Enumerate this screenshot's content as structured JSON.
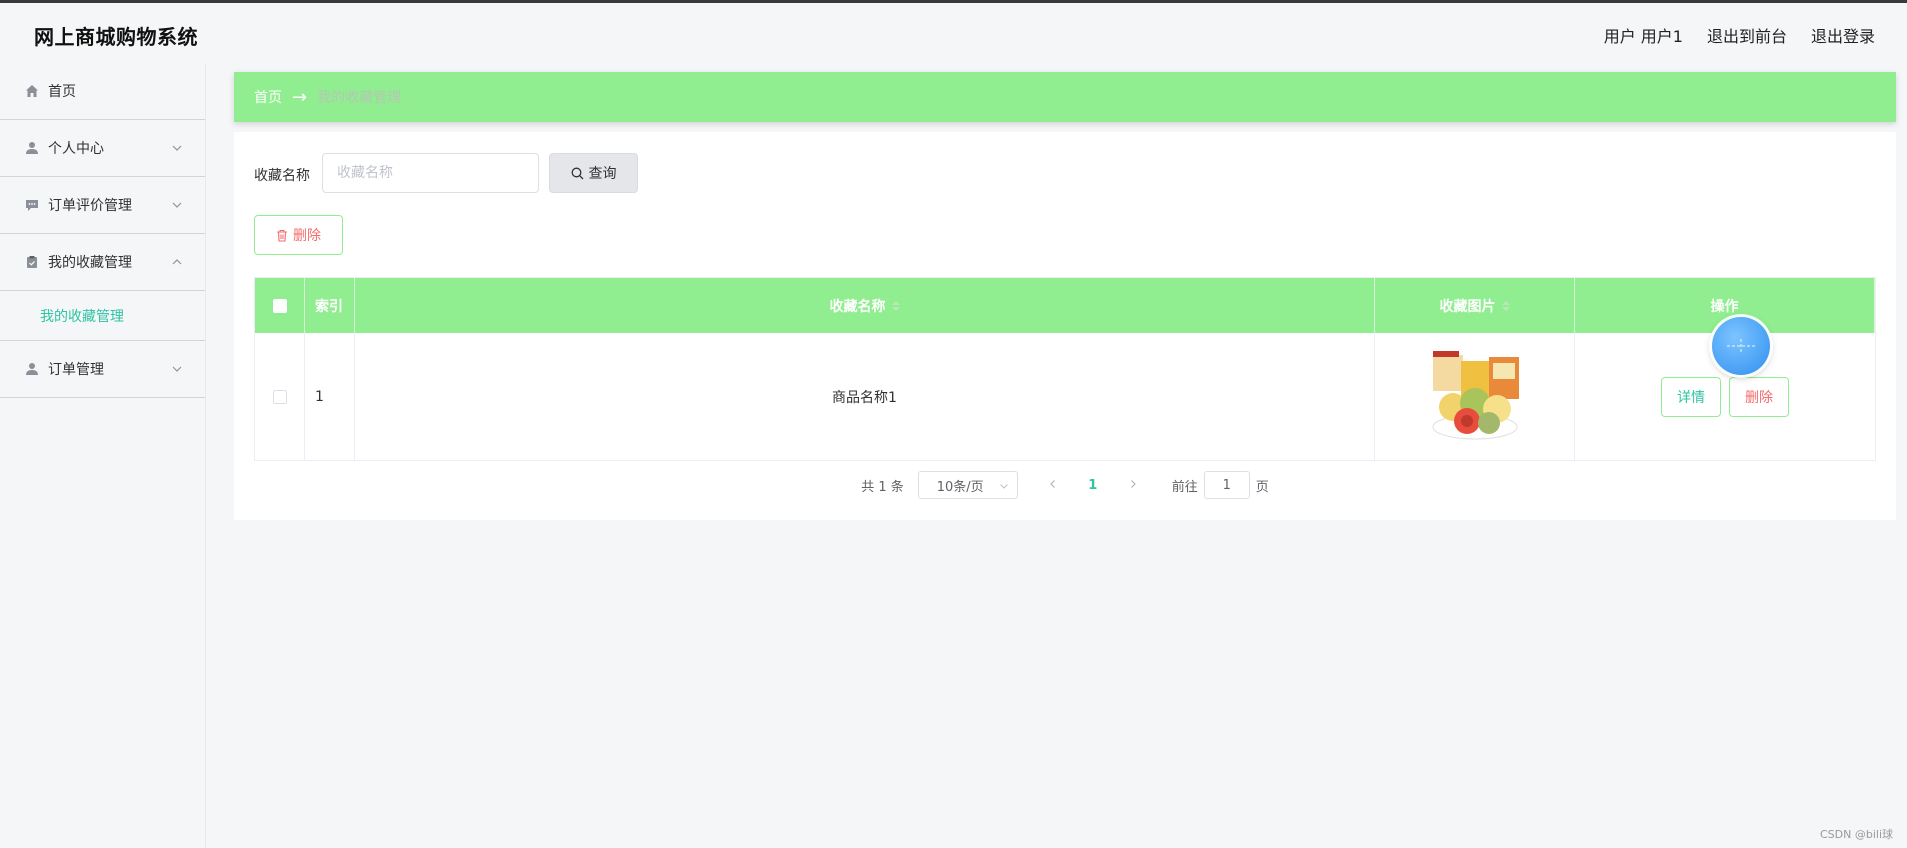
{
  "header": {
    "title": "网上商城购物系统",
    "user_label": "用户 用户1",
    "to_front": "退出到前台",
    "logout": "退出登录"
  },
  "sidebar": {
    "items": [
      {
        "label": "首页",
        "icon": "home-icon"
      },
      {
        "label": "个人中心",
        "icon": "user-icon"
      },
      {
        "label": "订单评价管理",
        "icon": "comment-icon"
      },
      {
        "label": "我的收藏管理",
        "icon": "clipboard-icon",
        "expanded": true,
        "children": [
          {
            "label": "我的收藏管理"
          }
        ]
      },
      {
        "label": "订单管理",
        "icon": "user-icon"
      }
    ]
  },
  "breadcrumb": {
    "home": "首页",
    "arrow": "→",
    "current": "我的收藏管理"
  },
  "search": {
    "label": "收藏名称",
    "placeholder": "收藏名称",
    "button": "查询"
  },
  "actions": {
    "delete": "删除"
  },
  "table": {
    "headers": {
      "index": "索引",
      "name": "收藏名称",
      "image": "收藏图片",
      "ops": "操作"
    },
    "rows": [
      {
        "index": "1",
        "name": "商品名称1",
        "detail": "详情",
        "delete": "删除"
      }
    ]
  },
  "pagination": {
    "total": "共 1 条",
    "page_size": "10条/页",
    "current_page": "1",
    "goto_prefix": "前往",
    "goto_value": "1",
    "goto_suffix": "页"
  },
  "watermark": "CSDN @bili球",
  "colors": {
    "accent_green": "#90ee90",
    "teal": "#2ec4a4",
    "danger": "#f56c6c"
  }
}
